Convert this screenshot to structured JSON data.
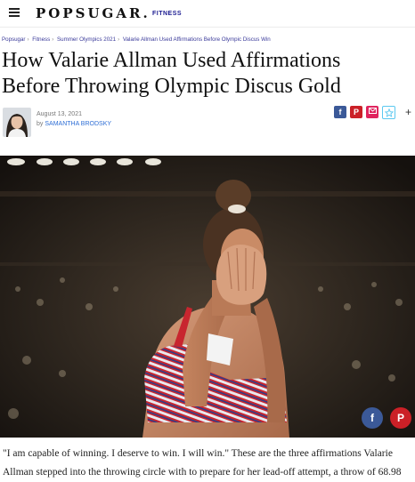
{
  "header": {
    "logo": "POPSUGAR.",
    "logo_section": "FITNESS"
  },
  "breadcrumb": [
    "Popsugar",
    "Fitness",
    "Summer Olympics 2021",
    "Valarie Allman Used Affirmations Before Olympic Discus Win"
  ],
  "article": {
    "title": "How Valarie Allman Used Affirmations Before Throwing Olympic Discus Gold",
    "date": "August 13, 2021",
    "by": "by",
    "author": "SAMANTHA BRODSKY",
    "body": "\"I am capable of winning. I deserve to win. I will win.\" These are the three affirmations Valarie Allman stepped into the throwing circle with to prepare for her lead-off attempt, a throw of 68.98"
  },
  "share": {
    "facebook": "f",
    "pinterest": "P",
    "more": "+"
  },
  "colors": {
    "brand_blue": "#1a1a90",
    "facebook": "#3b5998",
    "pinterest": "#cb2027",
    "email": "#e0245e",
    "save": "#5bc8f0"
  },
  "icons": [
    "menu-icon",
    "facebook-icon",
    "pinterest-icon",
    "email-icon",
    "star-icon",
    "plus-icon"
  ]
}
